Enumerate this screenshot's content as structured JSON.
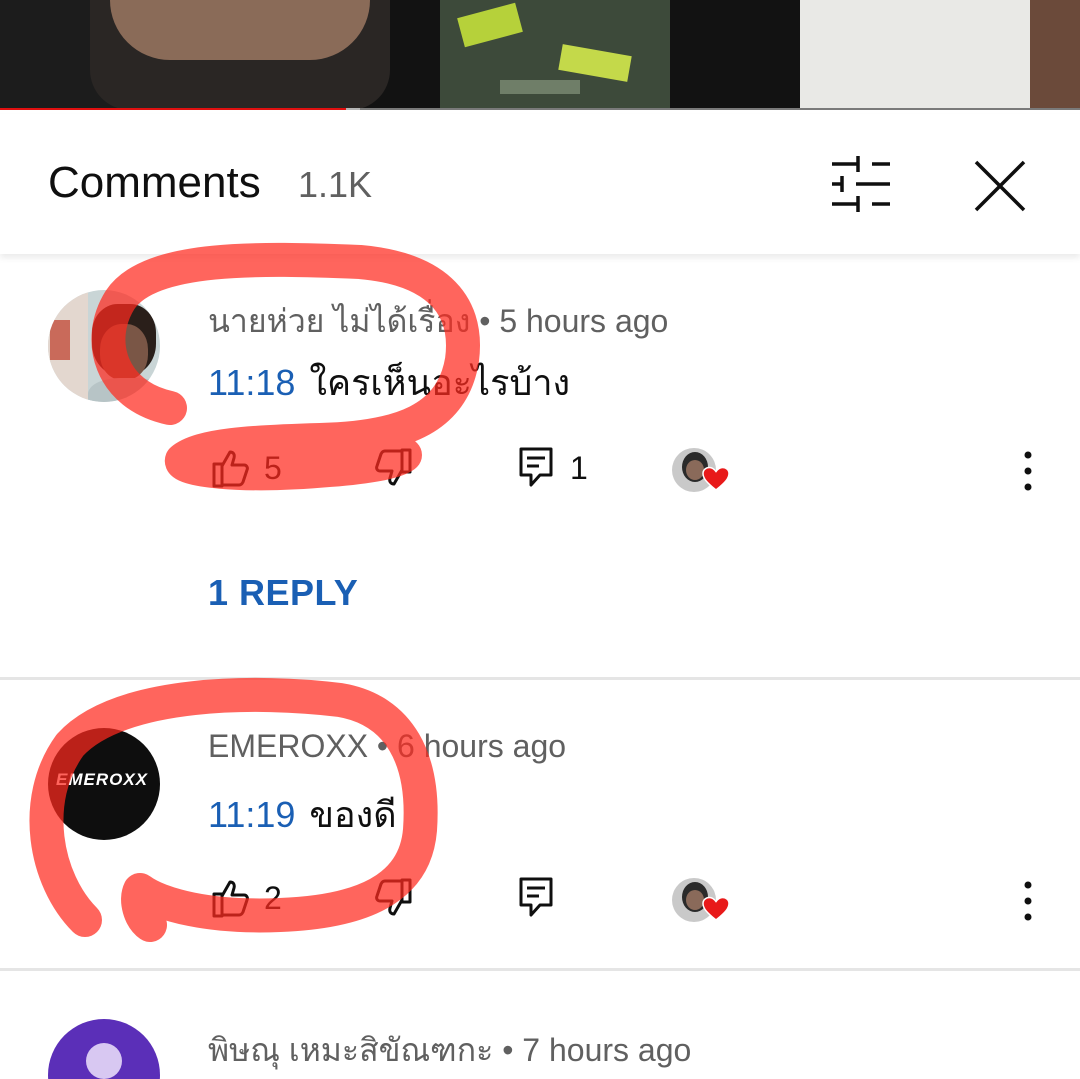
{
  "comments_header": {
    "title": "Comments",
    "count": "1.1K"
  },
  "icons": {
    "filter": "filter-sliders-icon",
    "close": "close-icon",
    "like": "thumbs-up-icon",
    "dislike": "thumbs-down-icon",
    "reply": "reply-comment-icon",
    "more": "more-vert-icon",
    "creator_heart": "creator-heart-icon"
  },
  "colors": {
    "link_blue": "#1a5fb4",
    "progress_red": "#e01010",
    "annotation_red": "#ff3b30"
  },
  "video_progress_fraction": 0.32,
  "comments": [
    {
      "author": "นายห่วย ไม่ได้เรื่อง",
      "time": "• 5 hours ago",
      "timestamp_link": "11:18",
      "text": "ใครเห็นอะไรบ้าง",
      "likes": "5",
      "reply_count": "1",
      "reply_link": "1 REPLY"
    },
    {
      "author": "EMEROXX",
      "avatar_text": "EMEROXX",
      "time": "• 6 hours ago",
      "timestamp_link": "11:19",
      "text": "ของดี",
      "likes": "2"
    },
    {
      "author": "พิษณุ เหมะสิขัณฑกะ",
      "time": "• 7 hours ago"
    }
  ]
}
